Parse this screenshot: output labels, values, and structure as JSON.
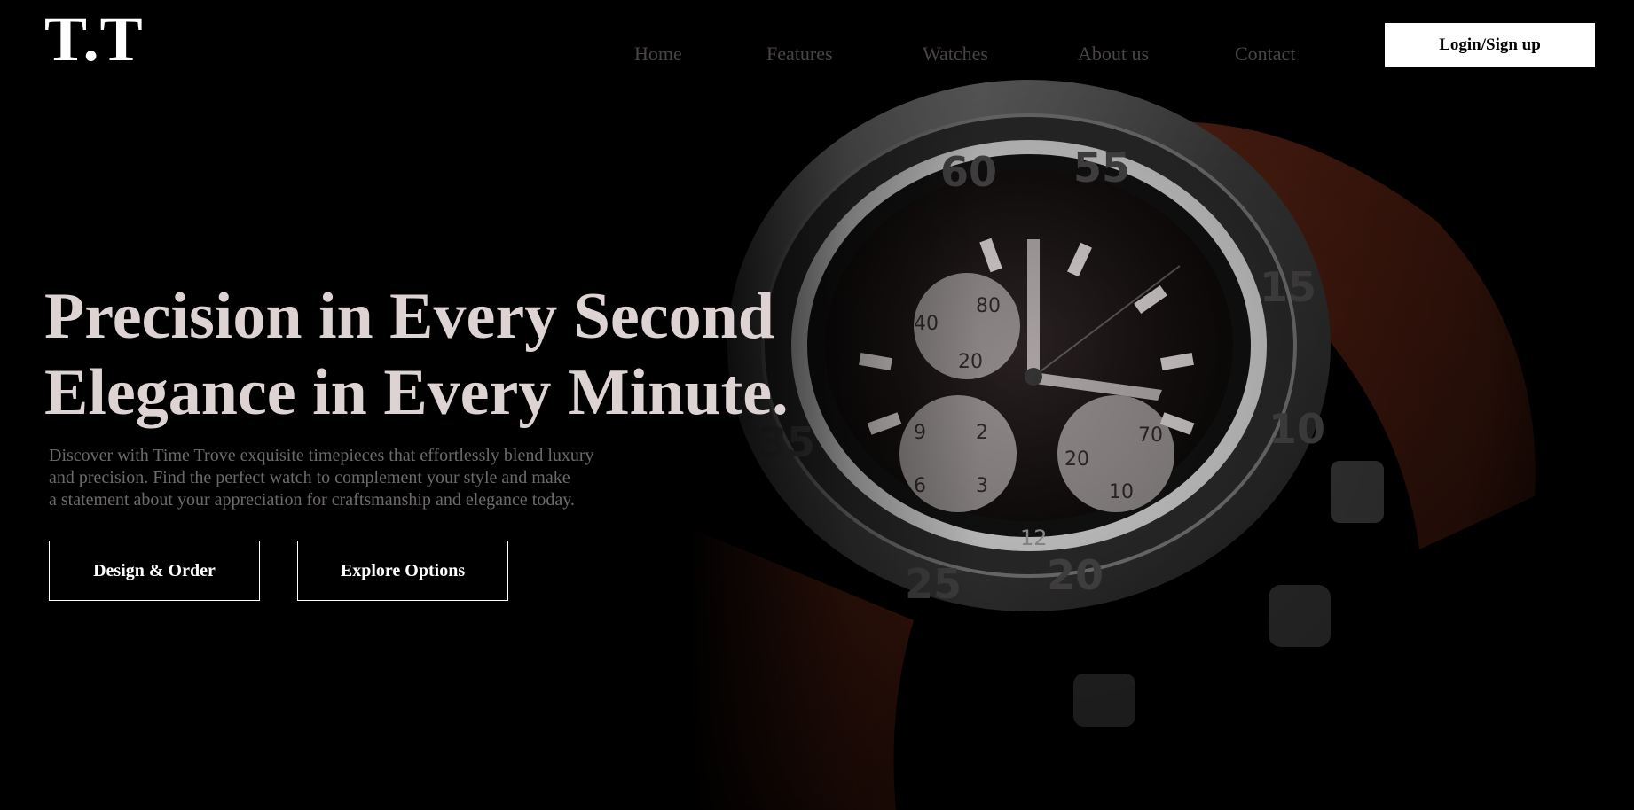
{
  "brand": {
    "logo_text": "T.T"
  },
  "nav": {
    "items": [
      "Home",
      "Features",
      "Watches",
      "About us",
      "Contact"
    ]
  },
  "header": {
    "login_label": "Login/Sign up"
  },
  "hero": {
    "headline_line1": "Precision in Every Second",
    "headline_line2": "Elegance in Every Minute.",
    "description_line1": "Discover with Time Trove exquisite timepieces that effortlessly blend luxury",
    "description_line2": "and precision. Find the perfect watch to complement your style and make",
    "description_line3": "a statement about your appreciation for craftsmanship and elegance today.",
    "primary_cta": "Design & Order",
    "secondary_cta": "Explore Options"
  },
  "dial": {
    "bezel_numbers": [
      "60",
      "55",
      "10",
      "15",
      "20",
      "25",
      "35"
    ],
    "subdial_left": [
      "80",
      "40",
      "20"
    ],
    "subdial_bottom_left": [
      "9",
      "2",
      "6",
      "3"
    ],
    "subdial_bottom_right": [
      "20",
      "10",
      "70"
    ],
    "hour_label": "12"
  },
  "colors": {
    "background": "#000000",
    "headline": "#ddd3d3",
    "nav_text": "#4a4444",
    "strap": "#5a2214",
    "steel": "#6a6a6a"
  }
}
